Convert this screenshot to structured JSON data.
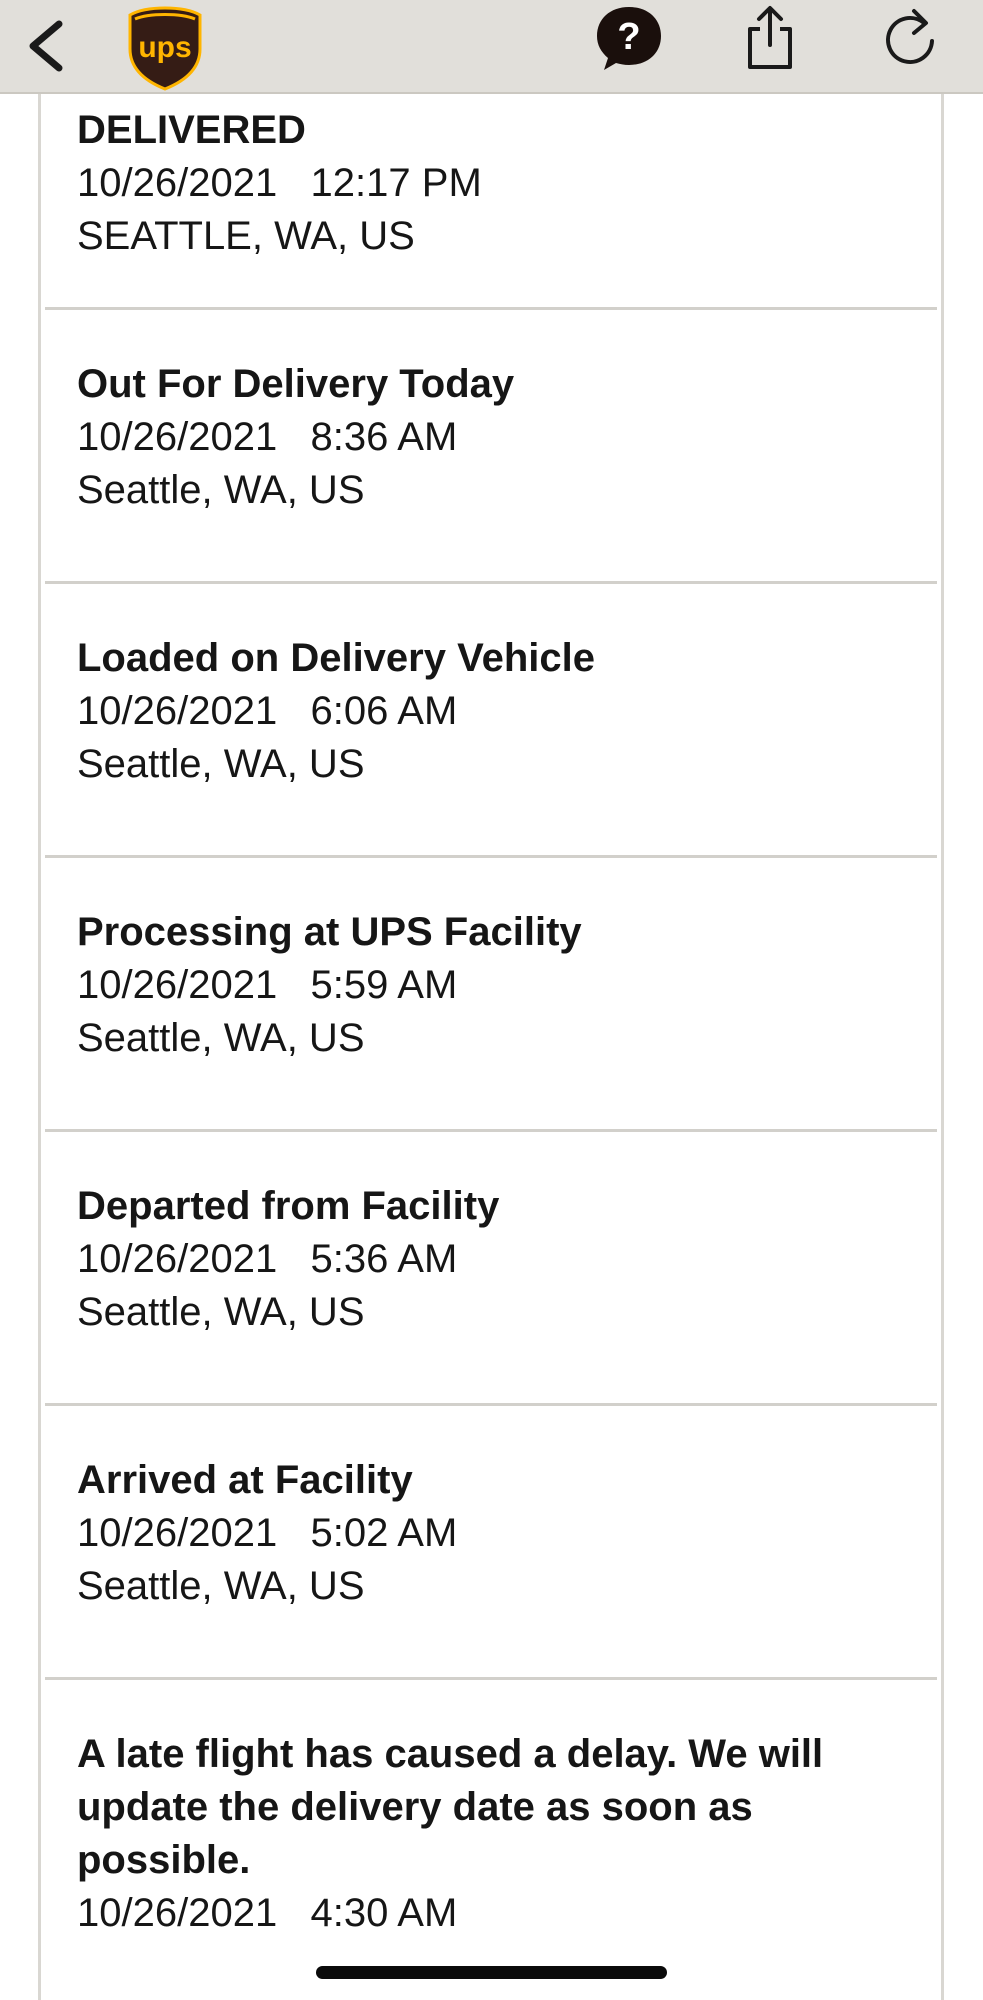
{
  "header": {
    "logo_text": "ups",
    "icons": {
      "back": "chevron-left-icon",
      "help": "question-bubble-icon",
      "share": "share-icon",
      "refresh": "refresh-icon"
    },
    "colors": {
      "bar": "#e1dfda",
      "ups_brown": "#351c15",
      "ups_gold": "#ffb500"
    }
  },
  "events": [
    {
      "status": "DELIVERED",
      "date": "10/26/2021",
      "time": "12:17 PM",
      "location": "SEATTLE, WA, US"
    },
    {
      "status": "Out For Delivery Today",
      "date": "10/26/2021",
      "time": "8:36 AM",
      "location": "Seattle, WA, US"
    },
    {
      "status": "Loaded on Delivery Vehicle",
      "date": "10/26/2021",
      "time": "6:06 AM",
      "location": "Seattle, WA, US"
    },
    {
      "status": "Processing at UPS Facility",
      "date": "10/26/2021",
      "time": "5:59 AM",
      "location": "Seattle, WA, US"
    },
    {
      "status": "Departed from Facility",
      "date": "10/26/2021",
      "time": "5:36 AM",
      "location": "Seattle, WA, US"
    },
    {
      "status": "Arrived at Facility",
      "date": "10/26/2021",
      "time": "5:02 AM",
      "location": "Seattle, WA, US"
    },
    {
      "status": "A late flight has caused a delay. We will update the delivery date as soon as possible.",
      "date": "10/26/2021",
      "time": "4:30 AM",
      "location": ""
    }
  ]
}
